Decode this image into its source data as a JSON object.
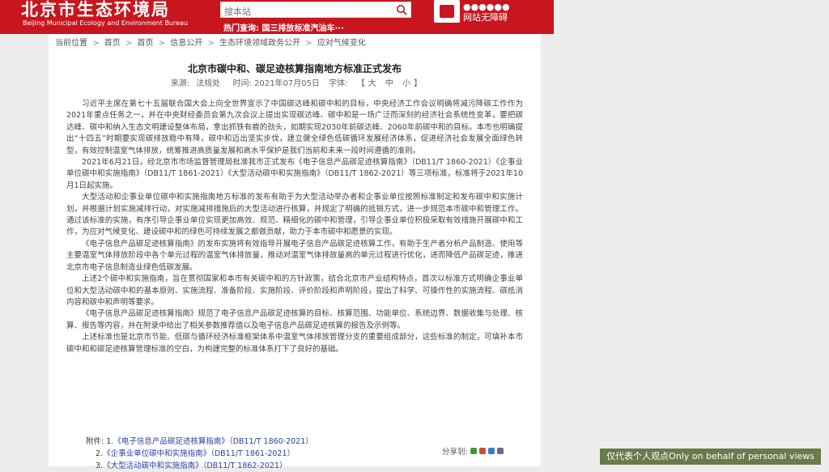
{
  "header": {
    "title": "北京市生态环境局",
    "subtitle": "Beijing Municipal Ecology and Environment Bureau",
    "search_placeholder": "搜本站",
    "hot_label": "热门查询:",
    "hot_query": "国三排放标准汽油车···",
    "barrier_free": "网站无障碍",
    "accent_color": "#c8161e"
  },
  "breadcrumb": {
    "label": "当前位置",
    "items": [
      "首页",
      "首页",
      "信息公开",
      "生态环境领域政务公开",
      "应对气候变化"
    ]
  },
  "article": {
    "title": "北京市碳中和、碳足迹核算指南地方标准正式发布",
    "source_label": "来源:",
    "source": "法规处",
    "date": "时间: 2021年07月05日",
    "font_label": "字体:",
    "font_sizes": [
      "大",
      "中",
      "小"
    ],
    "paragraphs": [
      "习近平主席在第七十五届联合国大会上向全世界宣示了中国碳达峰和碳中和的目标，中央经济工作会议明确将减污降碳工作作为2021年重点任务之一，并在中央财经委员会第九次会议上提出实现碳达峰、碳中和是一场广泛而深刻的经济社会系统性变革，要把碳达峰、碳中和纳入生态文明建设整体布局，拿出抓铁有痕的劲头，如期实现2030年前碳达峰、2060年前碳中和的目标。本市也明确提出“十四五”时期要实现碳排放稳中有降，碳中和迈出坚实步伐，建立健全绿色低碳循环发展经济体系，促进经济社会发展全面绿色转型，有效控制温室气体排放，统筹推进高质量发展和高水平保护是我们当前和未来一段时间遵循的准则。",
      "2021年6月21日，经北京市市场监督管理局批准我市正式发布《电子信息产品碳足迹核算指南》（DB11/T 1860-2021）《企事业单位碳中和实施指南》（DB11/T 1861-2021）《大型活动碳中和实施指南》（DB11/T 1862-2021）等三项标准，标准将于2021年10月1日起实施。",
      "大型活动和企事业单位碳中和实施指南地方标准的发布有助于为大型活动举办者和企事业单位按照标准制定和发布碳中和实施计划，并根据计划实施减排行动，对实施减排措施后的大型活动进行核算，并规定了明确的抵销方式，进一步规范本市碳中和管理工作。通过该标准的实施，有序引导企事业单位实现更加高效、规范、精细化的碳中和管理，引导企事业单位积极采取有效措施开展碳中和工作，为应对气候变化、建设碳中和的绿色可持续发展之都做贡献，助力于本市碳中和愿景的实现。",
      "《电子信息产品碳足迹核算指南》的发布实施将有效指导开展电子信息产品碳足迹核算工作，有助于生产者分析产品制造、使用等主要温室气体排放阶段中各个单元过程的温室气体排放量，推动对温室气体排放量高的单元过程进行优化，进而降低产品碳足迹，推进北京市电子信息制造业绿色低碳发展。",
      "上述2个碳中和实施指南，旨在贯彻国家和本市有关碳中和的方针政策，结合北京市产业结构特点，首次以标准方式明确企事业单位和大型活动碳中和的基本原则、实施流程、准备阶段、实施阶段、评价阶段和声明阶段，提出了科学、可操作性的实施流程、碳抵消内容和碳中和声明等要求。",
      "《电子信息产品碳足迹核算指南》规范了电子信息产品碳足迹核算的目标、核算范围、功能单位、系统边界、数据收集与处理、核算、报告等内容，并在附录中给出了相关参数推荐值以及电子信息产品碳足迹核算的报告及示例等。",
      "上述标准也是北京市节能、低碳与循环经济标准框架体系中温室气体排放管理分支的重要组成部分，这些标准的制定，可填补本市碳中和和碳足迹核算管理标准的空白，为构建完整的标准体系打下了良好的基础。"
    ],
    "attachments_label": "附件:",
    "attachments": [
      {
        "index": "1.",
        "name": "《电子信息产品碳足迹核算指南》",
        "code": "（DB11/T 1860-2021）"
      },
      {
        "index": "2.",
        "name": "《企事业单位碳中和实施指南》",
        "code": "（DB11/T 1861-2021）"
      },
      {
        "index": "3.",
        "name": "《大型活动碳中和实施指南》",
        "code": "（DB11/T 1862-2021）"
      }
    ],
    "share_label": "分享到:"
  },
  "disclaimer": "仅代表个人观点Only on behalf of personal views"
}
